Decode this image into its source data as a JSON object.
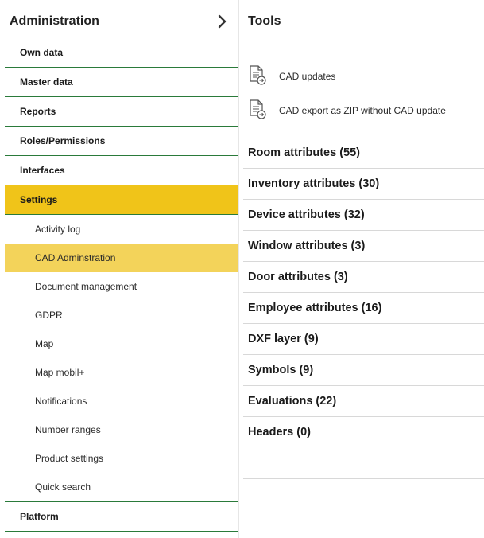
{
  "sidebar": {
    "title": "Administration",
    "items": [
      {
        "label": "Own data"
      },
      {
        "label": "Master data"
      },
      {
        "label": "Reports"
      },
      {
        "label": "Roles/Permissions"
      },
      {
        "label": "Interfaces"
      },
      {
        "label": "Settings"
      }
    ],
    "sub_items": [
      {
        "label": "Activity log"
      },
      {
        "label": "CAD Adminstration"
      },
      {
        "label": "Document management"
      },
      {
        "label": "GDPR"
      },
      {
        "label": "Map"
      },
      {
        "label": "Map mobil+"
      },
      {
        "label": "Notifications"
      },
      {
        "label": "Number ranges"
      },
      {
        "label": "Product settings"
      },
      {
        "label": "Quick search"
      }
    ],
    "footer_item": {
      "label": "Platform"
    },
    "active_item": "Settings",
    "active_sub_item": "CAD Adminstration"
  },
  "main": {
    "title": "Tools",
    "tools": [
      {
        "label": "CAD updates",
        "icon": "document-arrow-icon"
      },
      {
        "label": "CAD export as ZIP without CAD update",
        "icon": "document-arrow-icon"
      }
    ],
    "attributes": [
      {
        "label": "Room attributes (55)"
      },
      {
        "label": "Inventory attributes (30)"
      },
      {
        "label": "Device attributes (32)"
      },
      {
        "label": "Window attributes (3)"
      },
      {
        "label": "Door attributes (3)"
      },
      {
        "label": "Employee attributes (16)"
      },
      {
        "label": "DXF layer (9)"
      },
      {
        "label": "Symbols (9)"
      },
      {
        "label": "Evaluations (22)"
      },
      {
        "label": "Headers (0)"
      }
    ]
  },
  "colors": {
    "active_bg": "#f0c419",
    "active_sub_bg": "#f3d35a",
    "divider_green": "#2a7a3a",
    "divider_gray": "#d8d8d8"
  }
}
